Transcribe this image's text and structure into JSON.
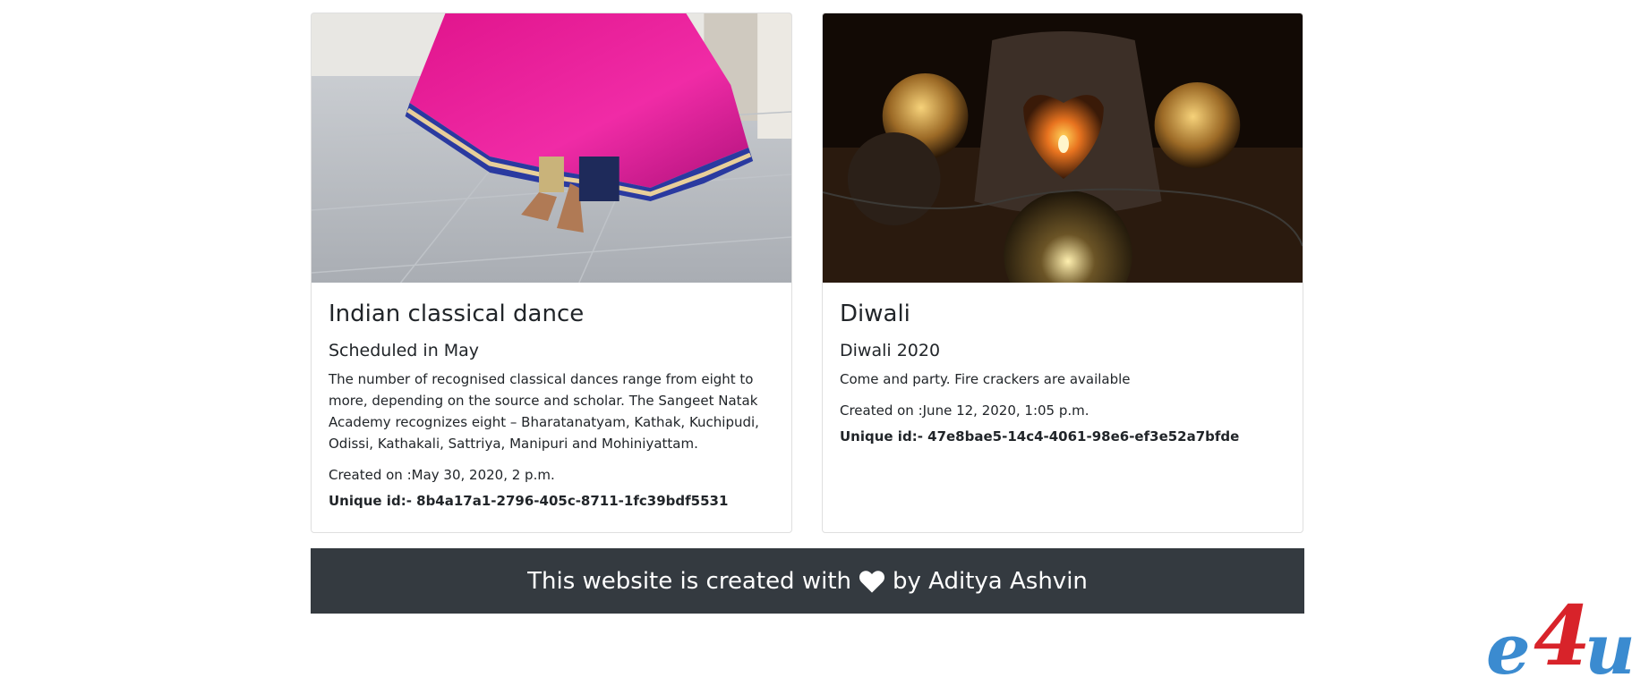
{
  "cards": [
    {
      "image_alt": "Indian classical dance",
      "title": "Indian classical dance",
      "subtitle": "Scheduled in May",
      "text": "The number of recognised classical dances range from eight to more, depending on the source and scholar. The Sangeet Natak Academy recognizes eight – Bharatanatyam, Kathak, Kuchipudi, Odissi, Kathakali, Sattriya, Manipuri and Mohiniyattam.",
      "created": "Created on :May 30, 2020, 2 p.m.",
      "uid": "Unique id:- 8b4a17a1-2796-405c-8711-1fc39bdf5531"
    },
    {
      "image_alt": "Diwali",
      "title": "Diwali",
      "subtitle": "Diwali 2020",
      "text": "Come and party. Fire crackers are available",
      "created": "Created on :June 12, 2020, 1:05 p.m.",
      "uid": "Unique id:- 47e8bae5-14c4-4061-98e6-ef3e52a7bfde"
    }
  ],
  "footer": {
    "before": "This website is created with",
    "after": "by Aditya Ashvin",
    "icon": "heart-icon"
  },
  "logo": {
    "text": "e4u"
  },
  "colors": {
    "footer_bg": "#343a40",
    "logo_blue": "#3b8bd0",
    "logo_red": "#d8232a"
  }
}
